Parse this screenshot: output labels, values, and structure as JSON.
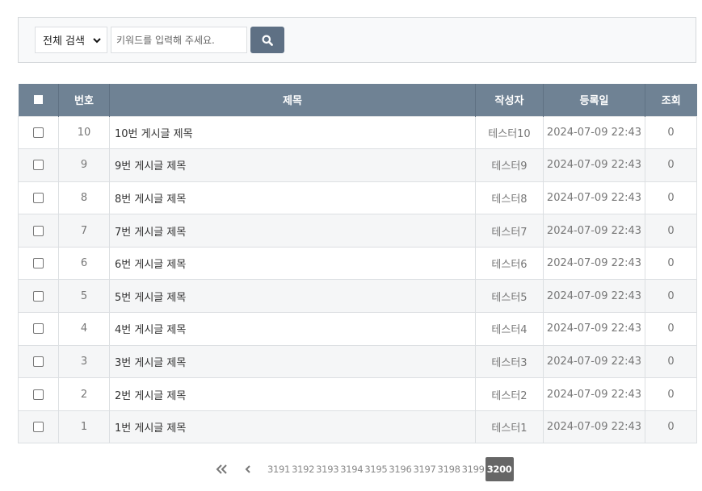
{
  "search": {
    "select_value": "전체 검색",
    "placeholder": "키워드를 입력해 주세요."
  },
  "table": {
    "headers": [
      "번호",
      "제목",
      "작성자",
      "등록일",
      "조회"
    ],
    "rows": [
      {
        "no": "10",
        "title": "10번 게시글 제목",
        "author": "테스터10",
        "date": "2024-07-09 22:43",
        "views": "0"
      },
      {
        "no": "9",
        "title": "9번 게시글 제목",
        "author": "테스터9",
        "date": "2024-07-09 22:43",
        "views": "0"
      },
      {
        "no": "8",
        "title": "8번 게시글 제목",
        "author": "테스터8",
        "date": "2024-07-09 22:43",
        "views": "0"
      },
      {
        "no": "7",
        "title": "7번 게시글 제목",
        "author": "테스터7",
        "date": "2024-07-09 22:43",
        "views": "0"
      },
      {
        "no": "6",
        "title": "6번 게시글 제목",
        "author": "테스터6",
        "date": "2024-07-09 22:43",
        "views": "0"
      },
      {
        "no": "5",
        "title": "5번 게시글 제목",
        "author": "테스터5",
        "date": "2024-07-09 22:43",
        "views": "0"
      },
      {
        "no": "4",
        "title": "4번 게시글 제목",
        "author": "테스터4",
        "date": "2024-07-09 22:43",
        "views": "0"
      },
      {
        "no": "3",
        "title": "3번 게시글 제목",
        "author": "테스터3",
        "date": "2024-07-09 22:43",
        "views": "0"
      },
      {
        "no": "2",
        "title": "2번 게시글 제목",
        "author": "테스터2",
        "date": "2024-07-09 22:43",
        "views": "0"
      },
      {
        "no": "1",
        "title": "1번 게시글 제목",
        "author": "테스터1",
        "date": "2024-07-09 22:43",
        "views": "0"
      }
    ]
  },
  "pagination": {
    "pages": [
      "3191",
      "3192",
      "3193",
      "3194",
      "3195",
      "3196",
      "3197",
      "3198",
      "3199",
      "3200"
    ],
    "current": "3200"
  },
  "icons": {
    "search": "search-icon",
    "first": "double-chevron-left-icon",
    "prev": "chevron-left-icon",
    "select": "chevron-down-icon"
  },
  "colors": {
    "header_bg": "#6f8294",
    "search_button": "#5e7084",
    "active_page": "#666666",
    "even_row": "#f5f6f7"
  }
}
